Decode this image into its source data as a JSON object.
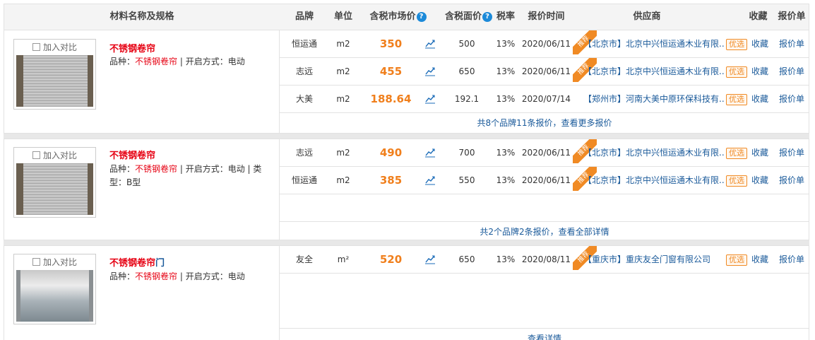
{
  "header": {
    "name_spec": "材料名称及规格",
    "brand": "品牌",
    "unit": "单位",
    "market_price": "含税市场价",
    "face_price": "含税面价",
    "tax_rate": "税率",
    "quote_time": "报价时间",
    "supplier": "供应商",
    "favorite": "收藏",
    "quote_sheet": "报价单"
  },
  "labels": {
    "compare": "加入对比",
    "recommend": "推荐",
    "preferred": "优选",
    "favorite": "收藏",
    "quote_sheet": "报价单"
  },
  "products": [
    {
      "name": "不锈钢卷帘",
      "name_suffix": "",
      "spec_prefix": "品种：",
      "spec_variety": "不锈钢卷帘",
      "spec_rest": " | 开启方式：电动",
      "more_text": "共8个品牌11条报价，查看更多报价",
      "rows": [
        {
          "brand": "恒运通",
          "unit": "m2",
          "price": "350",
          "face": "500",
          "tax": "13%",
          "date": "2020/06/11",
          "supplier": "【北京市】北京中兴恒运通木业有限..."
        },
        {
          "brand": "志远",
          "unit": "m2",
          "price": "455",
          "face": "650",
          "tax": "13%",
          "date": "2020/06/11",
          "supplier": "【北京市】北京中兴恒运通木业有限..."
        },
        {
          "brand": "大美",
          "unit": "m2",
          "price": "188.64",
          "face": "192.1",
          "tax": "13%",
          "date": "2020/07/14",
          "supplier": "【郑州市】河南大美中原环保科技有..."
        }
      ]
    },
    {
      "name": "不锈钢卷帘",
      "name_suffix": "",
      "spec_prefix": "品种：",
      "spec_variety": "不锈钢卷帘",
      "spec_rest": " | 开启方式：电动 | 类型：B型",
      "more_text": "共2个品牌2条报价，查看全部详情",
      "rows": [
        {
          "brand": "志远",
          "unit": "m2",
          "price": "490",
          "face": "700",
          "tax": "13%",
          "date": "2020/06/11",
          "supplier": "【北京市】北京中兴恒运通木业有限..."
        },
        {
          "brand": "恒运通",
          "unit": "m2",
          "price": "385",
          "face": "550",
          "tax": "13%",
          "date": "2020/06/11",
          "supplier": "【北京市】北京中兴恒运通木业有限..."
        }
      ]
    },
    {
      "name": "不锈钢卷帘",
      "name_suffix": "门",
      "spec_prefix": "品种：",
      "spec_variety": "不锈钢卷帘",
      "spec_rest": " | 开启方式：电动",
      "more_text": "查看详情",
      "rows": [
        {
          "brand": "友全",
          "unit": "m²",
          "price": "520",
          "face": "650",
          "tax": "13%",
          "date": "2020/08/11",
          "supplier": "【重庆市】重庆友全门窗有限公司"
        }
      ]
    }
  ]
}
